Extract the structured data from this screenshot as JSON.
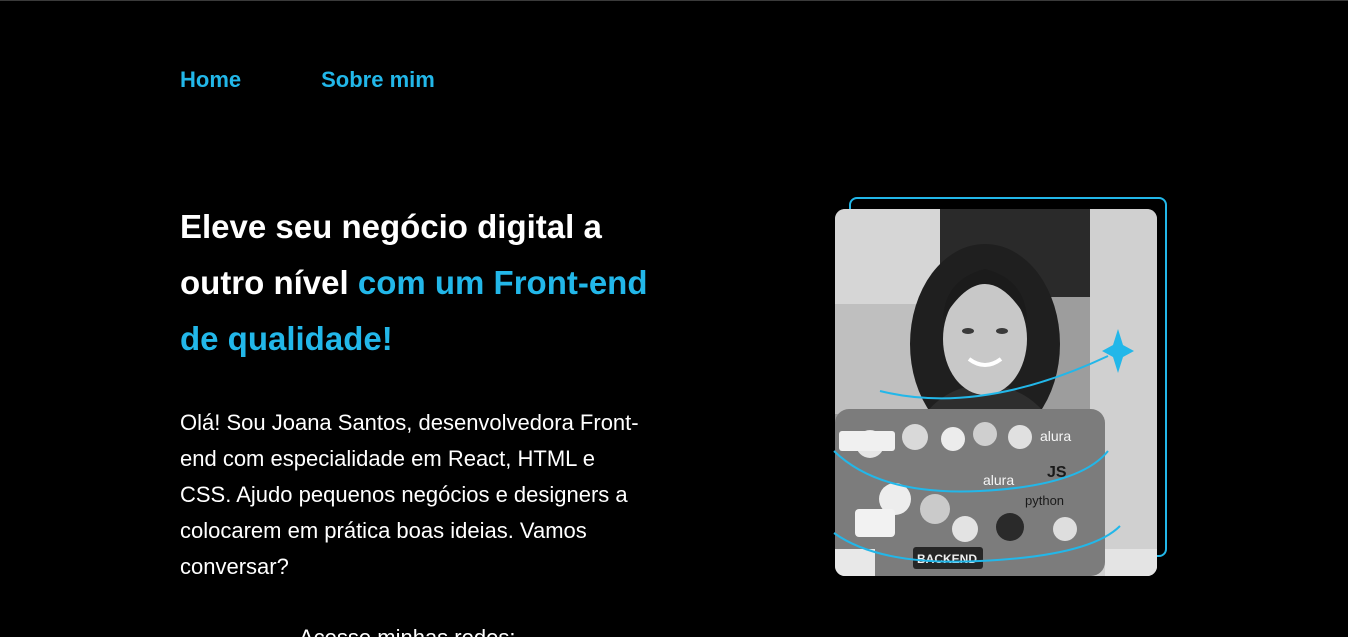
{
  "nav": {
    "home_label": "Home",
    "about_label": "Sobre mim"
  },
  "hero": {
    "headline_white": "Eleve seu negócio digital a outro nível ",
    "headline_accent": "com um Front-end de qualidade!",
    "intro": "Olá! Sou Joana Santos, desenvolvedora Front-end com especialidade em React, HTML e CSS. Ajudo pequenos negócios e designers a colocarem em prática boas ideias. Vamos conversar?",
    "social_title": "Acesse minhas redes:"
  },
  "photo": {
    "alt": "Foto de Joana Santos sorrindo em frente ao notebook",
    "sticker_alura": "alura",
    "sticker_js": "JS",
    "sticker_python": "python",
    "sticker_backend": "BACKEND"
  },
  "colors": {
    "background": "#000000",
    "accent": "#22b7e9",
    "text": "#ffffff"
  }
}
